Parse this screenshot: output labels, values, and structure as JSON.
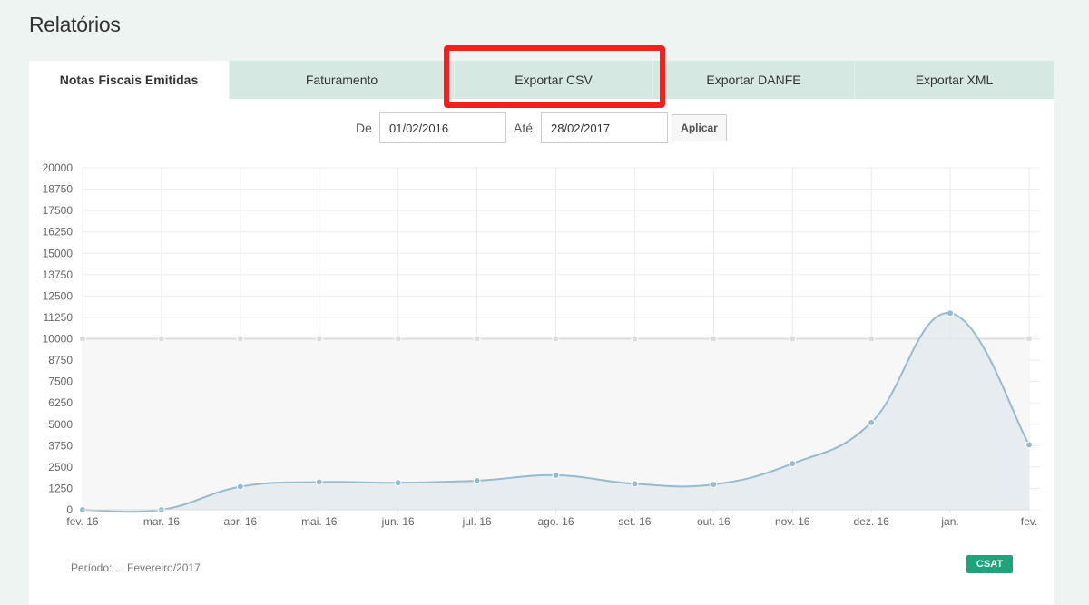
{
  "page": {
    "title": "Relatórios"
  },
  "tabs": [
    {
      "label": "Notas Fiscais Emitidas",
      "active": true
    },
    {
      "label": "Faturamento",
      "active": false
    },
    {
      "label": "Exportar CSV",
      "active": false,
      "highlighted": true
    },
    {
      "label": "Exportar DANFE",
      "active": false
    },
    {
      "label": "Exportar XML",
      "active": false
    }
  ],
  "filter": {
    "from_label": "De",
    "from_value": "01/02/2016",
    "to_label": "Até",
    "to_value": "28/02/2017",
    "apply_label": "Aplicar"
  },
  "chart_data": {
    "type": "area",
    "categories": [
      "fev. 16",
      "mar. 16",
      "abr. 16",
      "mai. 16",
      "jun. 16",
      "jul. 16",
      "ago. 16",
      "set. 16",
      "out. 16",
      "nov. 16",
      "dez. 16",
      "jan.",
      "fev."
    ],
    "y_ticks": [
      0,
      1250,
      2500,
      3750,
      5000,
      6250,
      7500,
      8750,
      10000,
      11250,
      12500,
      13750,
      15000,
      16250,
      17500,
      18750,
      20000
    ],
    "ylim": [
      0,
      20000
    ],
    "grid": true,
    "series": [
      {
        "values": [
          10000,
          10000,
          10000,
          10000,
          10000,
          10000,
          10000,
          10000,
          10000,
          10000,
          10000,
          10000,
          10000
        ],
        "color": "#dcdcdc",
        "fill": "#f7f7f7"
      },
      {
        "values": [
          0,
          0,
          1350,
          1620,
          1580,
          1700,
          2020,
          1520,
          1480,
          2700,
          5100,
          11500,
          3800
        ],
        "color": "#97bbcd",
        "fill": "#e3eaed"
      }
    ]
  },
  "footer": {
    "text": "Período: ... Fevereiro/2017",
    "button_label": "CSAT"
  }
}
